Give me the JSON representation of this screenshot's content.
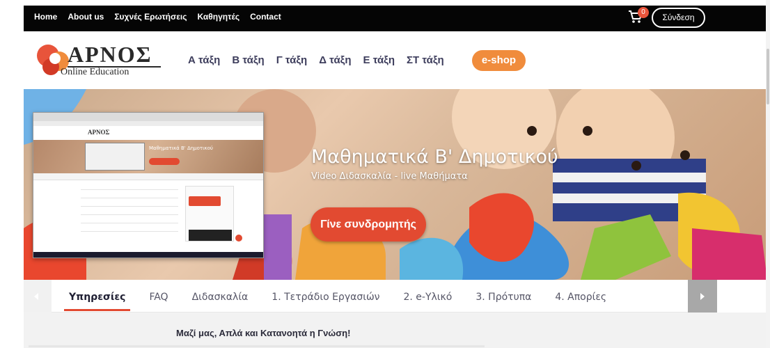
{
  "topbar": {
    "nav": [
      "Home",
      "About us",
      "Συχνές Ερωτήσεις",
      "Καθηγητές",
      "Contact"
    ],
    "cart_count": "0",
    "login_label": "Σύνδεση"
  },
  "header": {
    "logo_title": "ΑΡΝΟΣ",
    "logo_sub": "Online Education",
    "nav": [
      "Α τάξη",
      "Β τάξη",
      "Γ τάξη",
      "Δ τάξη",
      "Ε τάξη",
      "ΣΤ τάξη"
    ],
    "eshop_label": "e-shop"
  },
  "hero": {
    "title": "Μαθηματικά Β' Δημοτικού",
    "subtitle": "Video Διδασκαλία - live Μαθήματα",
    "cta_label": "Γίνε συνδρομητής"
  },
  "tabs": {
    "items": [
      "Υπηρεσίες",
      "FAQ",
      "Διδασκαλία",
      "1. Τετράδιο Εργασιών",
      "2. e-Υλικό",
      "3. Πρότυπα",
      "4. Απορίες"
    ],
    "active_index": 0
  },
  "band": {
    "text": "Μαζί μας, Απλά και Κατανοητά η Γνώση!"
  },
  "colors": {
    "accent": "#e24a31",
    "eshop": "#f08c3c",
    "topbar": "#050505"
  },
  "icons": {
    "cart": "shopping-cart-icon",
    "prev": "chevron-left-icon",
    "next": "chevron-right-icon"
  }
}
